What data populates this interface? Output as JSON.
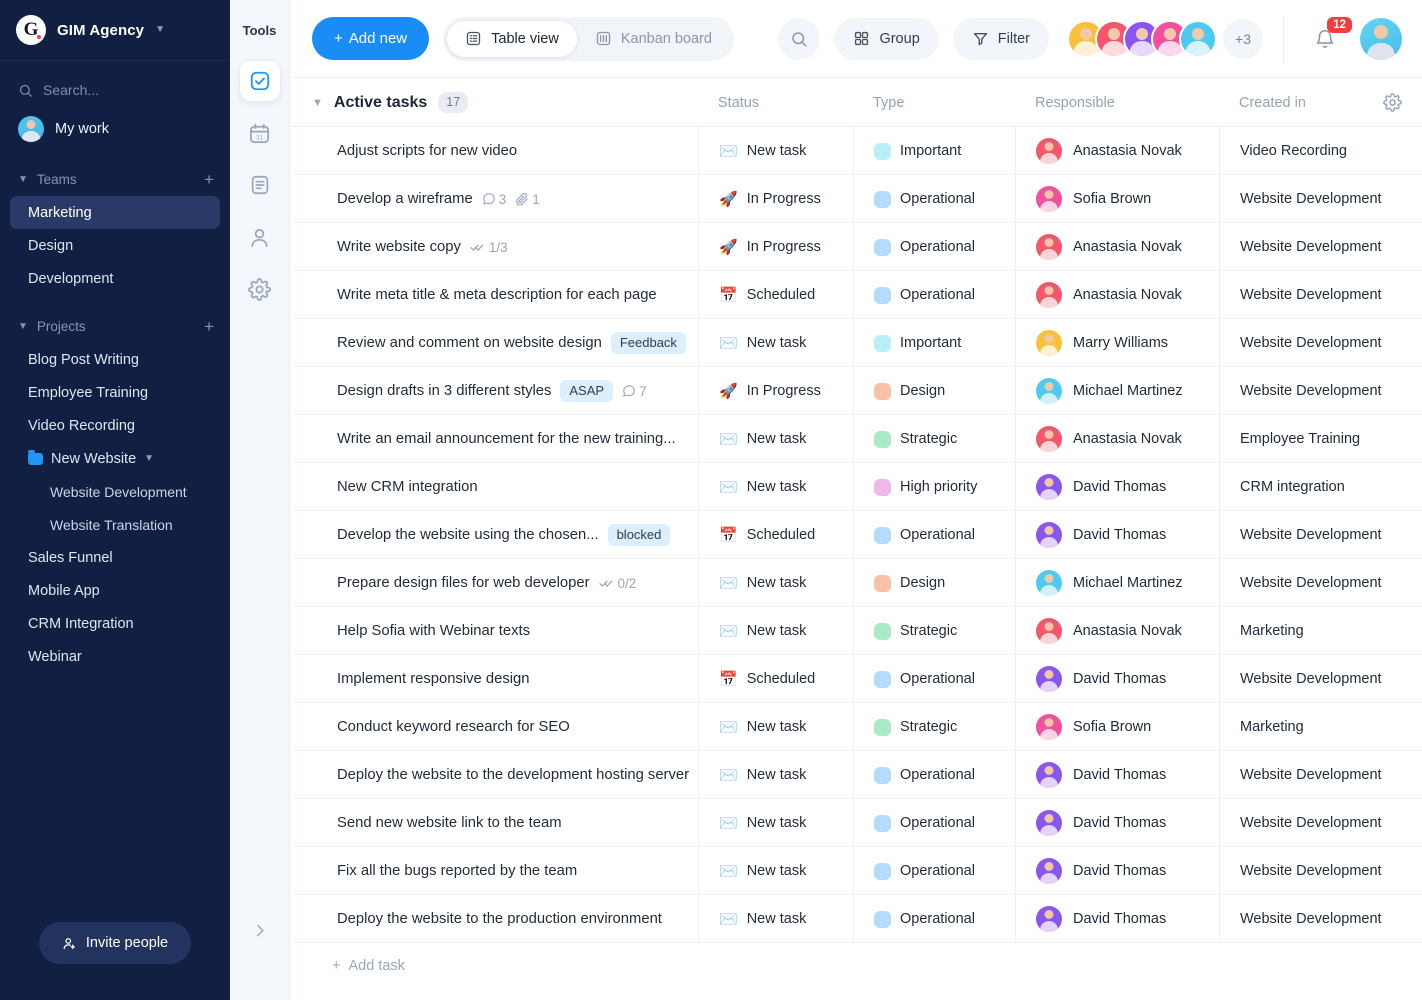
{
  "sidebar": {
    "brand": {
      "logo_letter": "G",
      "name": "GIM Agency",
      "caret_icon": "chevron-down-icon"
    },
    "search_placeholder": "Search...",
    "my_work_label": "My work",
    "teams": {
      "label": "Teams",
      "add_label": "+",
      "items": [
        {
          "label": "Marketing",
          "active": true
        },
        {
          "label": "Design",
          "active": false
        },
        {
          "label": "Development",
          "active": false
        }
      ]
    },
    "projects": {
      "label": "Projects",
      "add_label": "+",
      "items": [
        {
          "label": "Blog Post Writing",
          "type": "project"
        },
        {
          "label": "Employee Training",
          "type": "project"
        },
        {
          "label": "Video Recording",
          "type": "project"
        },
        {
          "label": "New Website",
          "type": "folder"
        },
        {
          "label": "Website Development",
          "type": "sub"
        },
        {
          "label": "Website Translation",
          "type": "sub"
        },
        {
          "label": "Sales Funnel",
          "type": "project"
        },
        {
          "label": "Mobile App",
          "type": "project"
        },
        {
          "label": "CRM Integration",
          "type": "project"
        },
        {
          "label": "Webinar",
          "type": "project"
        }
      ]
    },
    "invite_label": "Invite people"
  },
  "tools": {
    "title": "Tools",
    "items": [
      {
        "icon": "checkbox-check-icon",
        "active": true
      },
      {
        "icon": "calendar-31-icon",
        "active": false
      },
      {
        "icon": "document-lines-icon",
        "active": false
      },
      {
        "icon": "person-icon",
        "active": false
      },
      {
        "icon": "gear-icon",
        "active": false
      }
    ],
    "expand_icon": "chevron-right-icon"
  },
  "topbar": {
    "add_new_label": "Add new",
    "views": [
      {
        "label": "Table view",
        "icon": "table-icon",
        "active": true
      },
      {
        "label": "Kanban board",
        "icon": "kanban-icon",
        "active": false
      }
    ],
    "search_icon": "search-icon",
    "group_label": "Group",
    "filter_label": "Filter",
    "avatar_overflow": "+3",
    "notification_count": "12",
    "colors": {
      "accent": "#1a8cf5",
      "badge_red": "#f03d3d",
      "avatars": [
        "#f7c13c",
        "#f4576b",
        "#8b56f0",
        "#f2509f",
        "#4ec9ef"
      ]
    }
  },
  "table": {
    "section": {
      "title": "Active tasks",
      "count": "17"
    },
    "columns": [
      "",
      "Status",
      "Type",
      "Responsible",
      "Created in"
    ],
    "gear_icon": "gear-icon",
    "add_task_label": "Add task",
    "type_colors": {
      "Important": "#b9f0f5",
      "Operational": "#b5dcfa",
      "Design": "#fbc0a8",
      "Strategic": "#a8ebc4",
      "High priority": "#eeb9ea"
    },
    "status_icons": {
      "New task": "✉️",
      "In Progress": "🚀",
      "Scheduled": "📅"
    },
    "avatar_colors": {
      "Anastasia Novak": "#f4576b",
      "Sofia Brown": "#f2509f",
      "Marry Williams": "#f7c13c",
      "Michael Martinez": "#4ec9ef",
      "David Thomas": "#8b56f0"
    },
    "rows": [
      {
        "task": "Adjust scripts for new video",
        "tag": "",
        "comments": "",
        "attachments": "",
        "subtasks": "",
        "status": "New task",
        "type": "Important",
        "responsible": "Anastasia Novak",
        "created": "Video Recording"
      },
      {
        "task": "Develop a wireframe",
        "tag": "",
        "comments": "3",
        "attachments": "1",
        "subtasks": "",
        "status": "In Progress",
        "type": "Operational",
        "responsible": "Sofia Brown",
        "created": "Website Development"
      },
      {
        "task": "Write website copy",
        "tag": "",
        "comments": "",
        "attachments": "",
        "subtasks": "1/3",
        "status": "In Progress",
        "type": "Operational",
        "responsible": "Anastasia Novak",
        "created": "Website Development"
      },
      {
        "task": "Write meta title & meta description for each page",
        "tag": "",
        "comments": "",
        "attachments": "",
        "subtasks": "",
        "status": "Scheduled",
        "type": "Operational",
        "responsible": "Anastasia Novak",
        "created": "Website Development"
      },
      {
        "task": "Review and comment on website design",
        "tag": "Feedback",
        "comments": "",
        "attachments": "",
        "subtasks": "",
        "status": "New task",
        "type": "Important",
        "responsible": "Marry Williams",
        "created": "Website Development"
      },
      {
        "task": "Design drafts in 3 different styles",
        "tag": "ASAP",
        "comments": "7",
        "attachments": "",
        "subtasks": "",
        "status": "In Progress",
        "type": "Design",
        "responsible": "Michael Martinez",
        "created": "Website Development"
      },
      {
        "task": "Write an email announcement for the new training...",
        "tag": "",
        "comments": "",
        "attachments": "",
        "subtasks": "",
        "status": "New task",
        "type": "Strategic",
        "responsible": "Anastasia Novak",
        "created": "Employee Training"
      },
      {
        "task": "New CRM integration",
        "tag": "",
        "comments": "",
        "attachments": "",
        "subtasks": "",
        "status": "New task",
        "type": "High priority",
        "responsible": "David Thomas",
        "created": "CRM integration"
      },
      {
        "task": "Develop the website using the chosen...",
        "tag": "blocked",
        "comments": "",
        "attachments": "",
        "subtasks": "",
        "status": "Scheduled",
        "type": "Operational",
        "responsible": "David Thomas",
        "created": "Website Development"
      },
      {
        "task": "Prepare design files for web developer",
        "tag": "",
        "comments": "",
        "attachments": "",
        "subtasks": "0/2",
        "status": "New task",
        "type": "Design",
        "responsible": "Michael Martinez",
        "created": "Website Development"
      },
      {
        "task": "Help Sofia with Webinar texts",
        "tag": "",
        "comments": "",
        "attachments": "",
        "subtasks": "",
        "status": "New task",
        "type": "Strategic",
        "responsible": "Anastasia Novak",
        "created": "Marketing"
      },
      {
        "task": "Implement responsive design",
        "tag": "",
        "comments": "",
        "attachments": "",
        "subtasks": "",
        "status": "Scheduled",
        "type": "Operational",
        "responsible": "David Thomas",
        "created": "Website Development"
      },
      {
        "task": "Conduct keyword research for SEO",
        "tag": "",
        "comments": "",
        "attachments": "",
        "subtasks": "",
        "status": "New task",
        "type": "Strategic",
        "responsible": "Sofia Brown",
        "created": "Marketing"
      },
      {
        "task": "Deploy the website to the development hosting server",
        "tag": "",
        "comments": "",
        "attachments": "",
        "subtasks": "",
        "status": "New task",
        "type": "Operational",
        "responsible": "David Thomas",
        "created": "Website Development"
      },
      {
        "task": "Send new website link to the team",
        "tag": "",
        "comments": "",
        "attachments": "",
        "subtasks": "",
        "status": "New task",
        "type": "Operational",
        "responsible": "David Thomas",
        "created": "Website Development"
      },
      {
        "task": "Fix all the bugs reported by the team",
        "tag": "",
        "comments": "",
        "attachments": "",
        "subtasks": "",
        "status": "New task",
        "type": "Operational",
        "responsible": "David Thomas",
        "created": "Website Development"
      },
      {
        "task": "Deploy the website to the production environment",
        "tag": "",
        "comments": "",
        "attachments": "",
        "subtasks": "",
        "status": "New task",
        "type": "Operational",
        "responsible": "David Thomas",
        "created": "Website Development"
      }
    ]
  }
}
